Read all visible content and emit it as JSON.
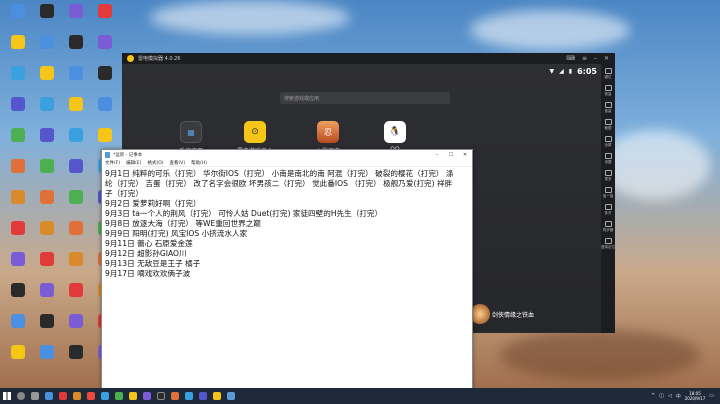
{
  "emulator": {
    "title": "雷电模拟器 4.0.26",
    "time": "6:05",
    "search_placeholder": "搜索游戏或应用",
    "apps": [
      {
        "label": "系统应用",
        "icon": "system-apps-icon",
        "color": "#3a3b40"
      },
      {
        "label": "雷电游戏中心",
        "icon": "game-center-icon",
        "color": "#f5c518"
      },
      {
        "label": "火影忍者",
        "icon": "naruto-icon",
        "color": "#e0703a"
      },
      {
        "label": "QQ",
        "icon": "qq-icon",
        "color": "#ffffff"
      }
    ],
    "banner_label": "剑侠情缘之铁血",
    "sidebar": [
      "键位",
      "音量",
      "音量",
      "截图",
      "全屏",
      "设置",
      "更多",
      "摇一摇",
      "多开",
      "同步器",
      "虚拟定位"
    ]
  },
  "notepad": {
    "title": "*运新 - 记事本",
    "menu": [
      "文件(F)",
      "编辑(E)",
      "格式(O)",
      "查看(V)",
      "帮助(H)"
    ],
    "lines": [
      "9月1日  纯粹的可乐（打完）  华尔街IOS（打完）  小南是南北的南  阿混（打完）  破裂的樱花（打完）  涤",
      "纶（打完）  吉蛋（打完）   改了名字会很欧  坏男孩二（打完）  觉此番IOS （打完）  极舰乃爱(打完)  祥胖",
      "子（打完）",
      "9月2日  爱萝莉好啊（打完）",
      "9月3日  ta一个人的荆风（打完）   可怜人姑 Duet(打完)  家徒四壁的H先生（打完）",
      "9月8日  放逐大海（打完）  等WE重回世界之巅",
      "9月9日  阳明(打完)  风宝IOS  小挤流水人家",
      "9月11日  蕾心  石原爱金莲",
      "9月12日  超影孙GIAO川",
      "9月13日  无敌豆是王子  橘子",
      "9月17日  嘀戏欢欢俩子波"
    ]
  },
  "taskbar": {
    "lang": "中",
    "clock_time": "18:05",
    "clock_date": "2020/9/17"
  }
}
